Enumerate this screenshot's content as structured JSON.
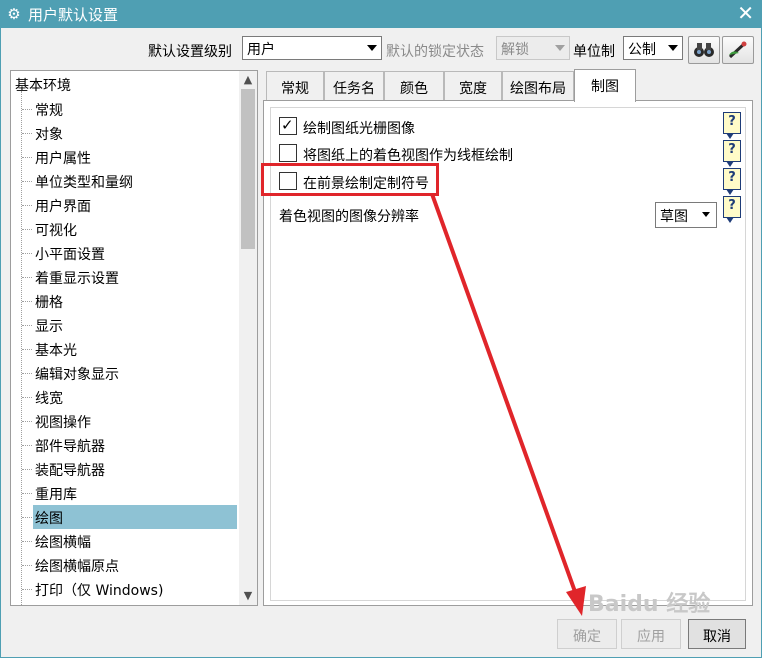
{
  "window": {
    "title": "用户默认设置",
    "close_glyph": "✕",
    "gear_glyph": "⚙"
  },
  "topbar": {
    "level_label": "默认设置级别",
    "level_value": "用户",
    "lock_label": "默认的锁定状态",
    "lock_value": "解锁",
    "units_label": "单位制",
    "units_value": "公制"
  },
  "tree": {
    "root": "基本环境",
    "items": [
      "常规",
      "对象",
      "用户属性",
      "单位类型和量纲",
      "用户界面",
      "可视化",
      "小平面设置",
      "着重显示设置",
      "栅格",
      "显示",
      "基本光",
      "编辑对象显示",
      "线宽",
      "视图操作",
      "部件导航器",
      "装配导航器",
      "重用库",
      "绘图",
      "绘图横幅",
      "绘图横幅原点",
      "打印（仅 Windows)"
    ],
    "selected_index": 17
  },
  "tabs": [
    "常规",
    "任务名",
    "颜色",
    "宽度",
    "绘图布局",
    "制图"
  ],
  "active_tab": 5,
  "options": [
    {
      "label": "绘制图纸光栅图像",
      "checked": true
    },
    {
      "label": "将图纸上的着色视图作为线框绘制",
      "checked": false
    },
    {
      "label": "在前景绘制定制符号",
      "checked": false
    }
  ],
  "resolution": {
    "label": "着色视图的图像分辨率",
    "value": "草图"
  },
  "help_glyph": "?",
  "buttons": {
    "ok": "确定",
    "apply": "应用",
    "cancel": "取消"
  },
  "watermark": "Baidu 经验",
  "colors": {
    "titlebar": "#4f9fb3",
    "selection": "#8ec2d4",
    "annotation": "#e0252a"
  }
}
